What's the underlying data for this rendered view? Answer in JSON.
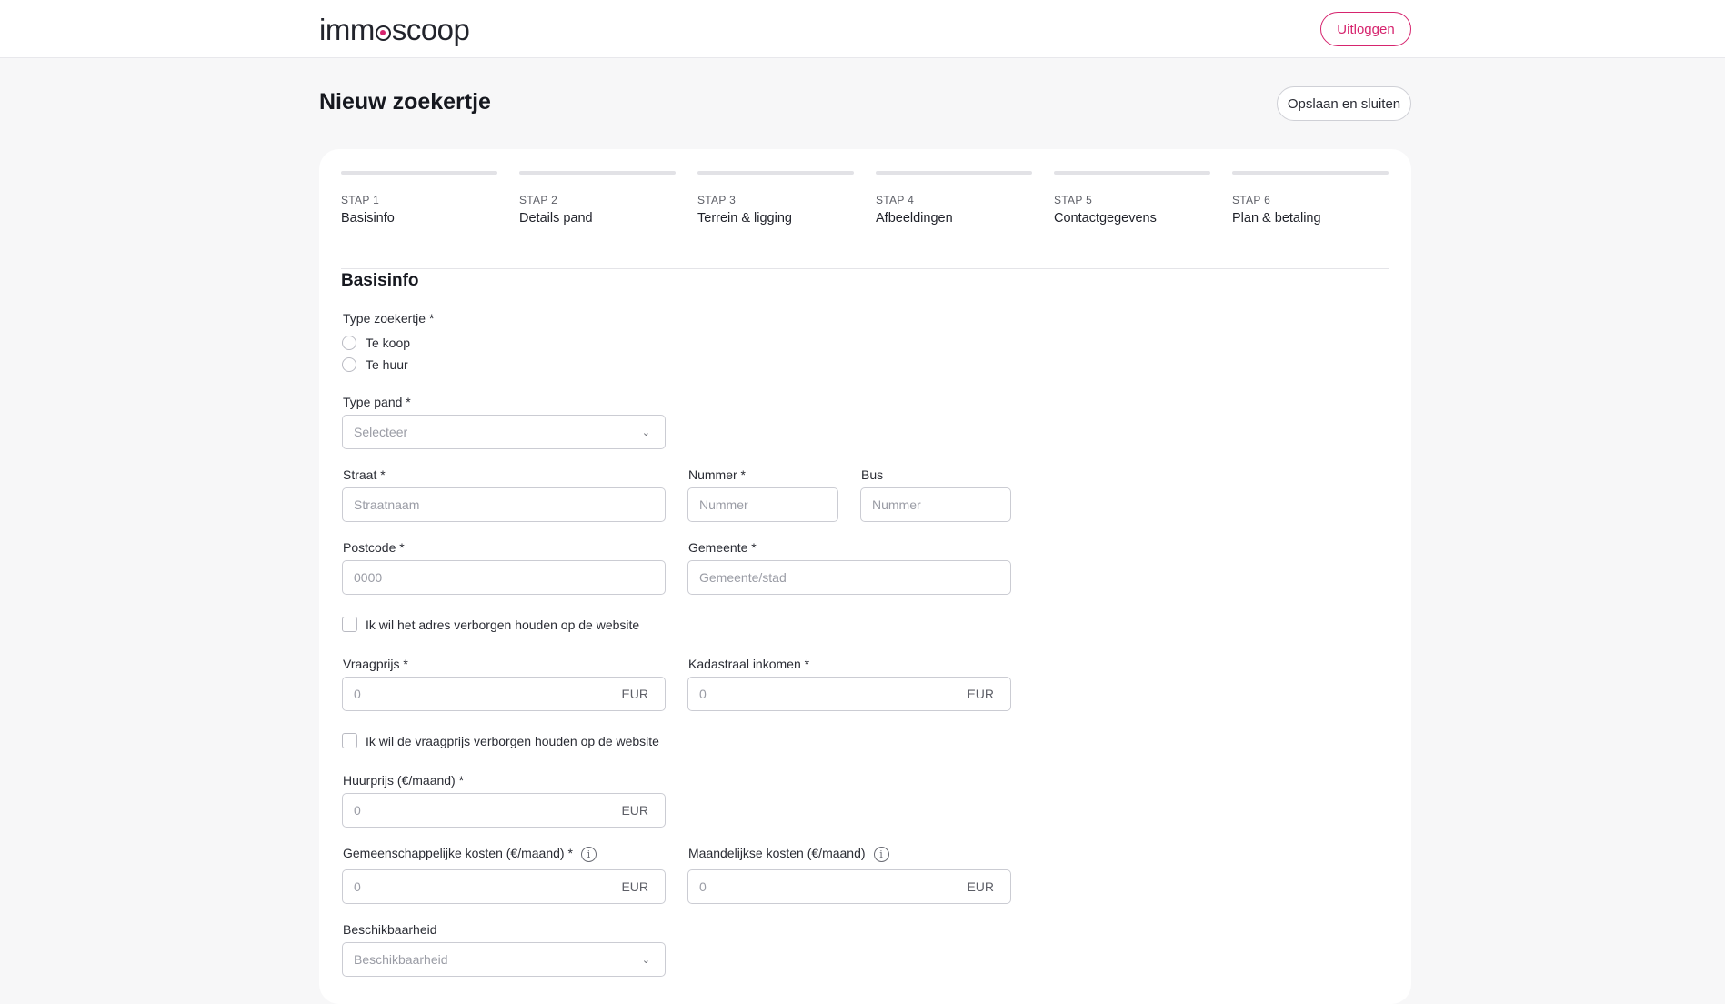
{
  "header": {
    "logo": {
      "left": "imm",
      "right": "scoop"
    },
    "logout_label": "Uitloggen"
  },
  "page": {
    "title": "Nieuw zoekertje",
    "save_close_label": "Opslaan en sluiten"
  },
  "steps": [
    {
      "num": "STAP 1",
      "label": "Basisinfo"
    },
    {
      "num": "STAP 2",
      "label": "Details pand"
    },
    {
      "num": "STAP 3",
      "label": "Terrein & ligging"
    },
    {
      "num": "STAP 4",
      "label": "Afbeeldingen"
    },
    {
      "num": "STAP 5",
      "label": "Contactgegevens"
    },
    {
      "num": "STAP 6",
      "label": "Plan & betaling"
    }
  ],
  "form": {
    "section_title": "Basisinfo",
    "type_zoekertje": {
      "label": "Type zoekertje *",
      "options": [
        "Te koop",
        "Te huur"
      ]
    },
    "type_pand": {
      "label": "Type pand *",
      "placeholder": "Selecteer"
    },
    "straat": {
      "label": "Straat *",
      "placeholder": "Straatnaam"
    },
    "nummer": {
      "label": "Nummer *",
      "placeholder": "Nummer"
    },
    "bus": {
      "label": "Bus",
      "placeholder": "Nummer"
    },
    "postcode": {
      "label": "Postcode *",
      "placeholder": "0000"
    },
    "gemeente": {
      "label": "Gemeente *",
      "placeholder": "Gemeente/stad"
    },
    "hide_address_label": "Ik wil het adres verborgen houden op de website",
    "vraagprijs": {
      "label": "Vraagprijs *",
      "placeholder": "0",
      "unit": "EUR"
    },
    "kadastraal": {
      "label": "Kadastraal inkomen *",
      "placeholder": "0",
      "unit": "EUR"
    },
    "hide_price_label": "Ik wil de vraagprijs verborgen houden op de website",
    "huurprijs": {
      "label": "Huurprijs (€/maand) *",
      "placeholder": "0",
      "unit": "EUR"
    },
    "gemeenschappelijke": {
      "label": "Gemeenschappelijke kosten (€/maand) *",
      "placeholder": "0",
      "unit": "EUR"
    },
    "maandelijkse": {
      "label": "Maandelijkse kosten (€/maand)",
      "placeholder": "0",
      "unit": "EUR"
    },
    "beschikbaarheid": {
      "label": "Beschikbaarheid",
      "placeholder": "Beschikbaarheid"
    }
  },
  "colors": {
    "accent": "#d6246e",
    "background": "#f7f7f8",
    "card": "#ffffff"
  }
}
